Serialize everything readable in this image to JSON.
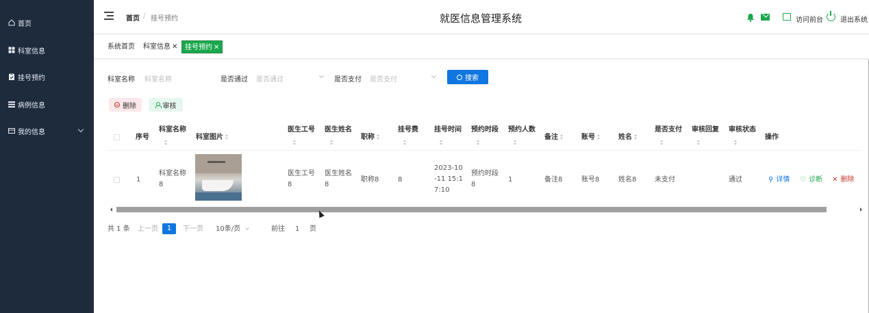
{
  "sidebar": {
    "items": [
      {
        "label": "首页",
        "icon": "home-icon"
      },
      {
        "label": "科室信息",
        "icon": "grid-icon"
      },
      {
        "label": "挂号预约",
        "icon": "clipboard-icon"
      },
      {
        "label": "病例信息",
        "icon": "list-icon"
      },
      {
        "label": "我的信息",
        "icon": "user-card-icon"
      }
    ]
  },
  "header": {
    "breadcrumb_home": "首页",
    "breadcrumb_sep": "/",
    "breadcrumb_current": "挂号预约",
    "title": "就医信息管理系统",
    "front_label": "访问前台",
    "logout_label": "退出系统",
    "accent_color": "#1aa84c"
  },
  "tabs": [
    {
      "label": "系统首页",
      "closable": false
    },
    {
      "label": "科室信息",
      "closable": true
    },
    {
      "label": "挂号预约",
      "closable": true,
      "active": true
    }
  ],
  "filters": {
    "dept_label": "科室名称",
    "dept_placeholder": "科室名称",
    "passed_label": "是否通过",
    "passed_placeholder": "是否通过",
    "paid_label": "是否支付",
    "paid_placeholder": "是否支付",
    "search_label": "搜索"
  },
  "actions": {
    "delete_label": "删除",
    "audit_label": "审核"
  },
  "table": {
    "headers": {
      "index": "序号",
      "dept_name": "科室名称",
      "dept_image": "科室图片",
      "doctor_no": "医生工号",
      "doctor_name": "医生姓名",
      "title": "职称",
      "fee": "挂号费",
      "reg_time": "挂号时间",
      "slot": "预约时段",
      "count": "预约人数",
      "note": "备注",
      "account": "账号",
      "name": "姓名",
      "paid": "是否支付",
      "reply": "审核回复",
      "status": "审核状态",
      "ops": "操作"
    },
    "rows": [
      {
        "index": "1",
        "dept_name_1": "科室名称",
        "dept_name_2": "8",
        "doctor_no_1": "医生工号",
        "doctor_no_2": "8",
        "doctor_name_1": "医生姓名",
        "doctor_name_2": "8",
        "title": "职称8",
        "fee": "8",
        "reg_time_1": "2023-10",
        "reg_time_2": "-11 15:1",
        "reg_time_3": "7:10",
        "slot_1": "预约时段",
        "slot_2": "8",
        "count": "1",
        "note": "备注8",
        "account": "账号8",
        "name": "姓名8",
        "paid": "未支付",
        "reply": "",
        "status": "通过",
        "op_detail": "详情",
        "op_diagnose": "诊断",
        "op_delete": "删除"
      }
    ]
  },
  "pagination": {
    "total": "共 1 条",
    "prev": "上一页",
    "current": "1",
    "next": "下一页",
    "page_size": "10条/页",
    "goto_label": "前往",
    "goto_value": "1",
    "page_unit": "页"
  }
}
